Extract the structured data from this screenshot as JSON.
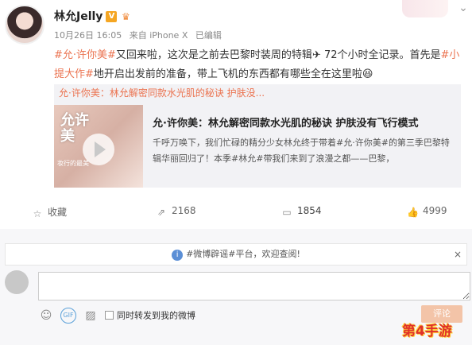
{
  "post": {
    "username": "林允Jelly",
    "vip_badge": "V",
    "meta": {
      "date": "10月26日 16:05",
      "source": "来自 iPhone X",
      "status": "已编辑"
    },
    "text": {
      "tag1": "#允·许你美#",
      "part1": "又回来啦，这次是之前去巴黎时装周的特辑",
      "emoji_plane": "✈",
      "part2": " 72个小时全记录。首先是",
      "tag2": "#小提大作#",
      "part3": "地开启出发前的准备，带上飞机的东西都有哪些全在这里啦",
      "emoji_face": "😆"
    },
    "card": {
      "header": "允·许你美：林允解密同款水光肌的秘诀 护肤没...",
      "thumb_title": "允许\n美",
      "thumb_sub": "妆行的最美",
      "title": "允·许你美：林允解密同款水光肌的秘诀 护肤没有飞行模式",
      "body_part1": "千呼万唤下，我们忙碌的精分少女林允终于带着",
      "body_tag": "#允·许你美#",
      "body_part2": "的第三季巴黎特辑华丽回归了！本季",
      "body_tag2": "#林允#",
      "body_part3": "带我们来到了浪漫之都——巴黎，"
    },
    "actions": {
      "favorite": "收藏",
      "repost": "2168",
      "comment": "1854",
      "like": "4999"
    }
  },
  "comments": {
    "notice": "#微博辟谣#平台，欢迎查阅!",
    "close": "×",
    "input_placeholder": "",
    "repost_label": "同时转发到我的微博",
    "submit_label": "评论"
  },
  "watermark": "第4手游",
  "icons": {
    "vip": "vip-badge-icon",
    "crown": "crown-icon",
    "chevron": "chevron-down-icon",
    "favorite": "star-icon",
    "repost": "repost-icon",
    "comment": "comment-icon",
    "like": "thumbs-up-icon",
    "emoji": "emoji-icon",
    "gif": "gif-icon",
    "image": "image-icon",
    "info": "info-icon",
    "play": "play-icon"
  },
  "colors": {
    "link": "#eb7350",
    "submit_bg": "#f3c4a8",
    "info": "#5b8fd6"
  }
}
